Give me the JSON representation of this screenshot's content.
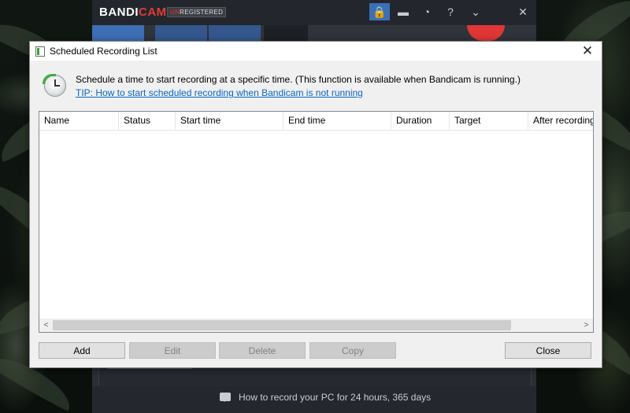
{
  "bandicam": {
    "logo_main": "BANDI",
    "logo_accent": "CAM",
    "unregistered_prefix": "UN",
    "unregistered_rest": "REGISTERED",
    "toolbar_icons": [
      "lock-icon",
      "folder-icon",
      "clock-icon",
      "help-icon",
      "minimize-icon",
      "close-icon"
    ],
    "toolbar_glyphs": {
      "lock": "🔒",
      "folder": "▬",
      "clock": "◔",
      "help": "?",
      "minimize": "⌄",
      "close": "✕"
    },
    "footer_text": "How to record your PC for 24 hours, 365 days",
    "record_color": "#e03636",
    "accent_color": "#3d6fb5"
  },
  "dialog": {
    "title": "Scheduled Recording List",
    "close_glyph": "✕",
    "message": "Schedule a time to start recording at a specific time. (This function is available when Bandicam is running.)",
    "tip_link": "TIP: How to start scheduled recording when Bandicam is not running",
    "link_color": "#0a67c9",
    "columns": [
      "Name",
      "Status",
      "Start time",
      "End time",
      "Duration",
      "Target",
      "After recording"
    ],
    "rows": [],
    "scroll_left": "<",
    "scroll_right": ">",
    "buttons": {
      "add": "Add",
      "edit": "Edit",
      "delete": "Delete",
      "copy": "Copy",
      "close": "Close"
    }
  }
}
